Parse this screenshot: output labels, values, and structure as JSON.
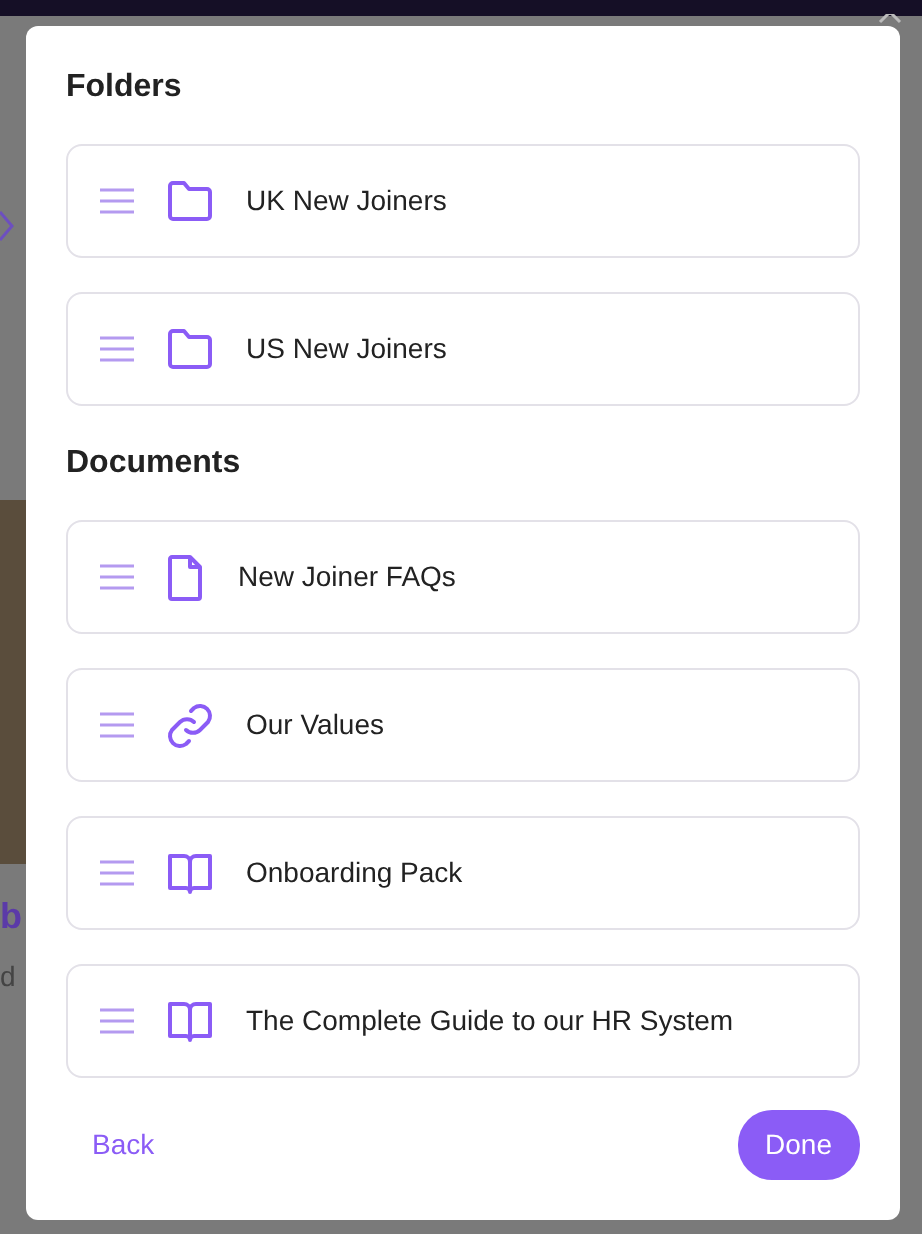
{
  "background": {
    "title_fragment": "b",
    "text_fragment": "d"
  },
  "sections": [
    {
      "title": "Folders",
      "items": [
        {
          "kind": "folder",
          "label": "UK New Joiners"
        },
        {
          "kind": "folder",
          "label": "US New Joiners"
        }
      ]
    },
    {
      "title": "Documents",
      "items": [
        {
          "kind": "file",
          "label": "New Joiner FAQs"
        },
        {
          "kind": "link",
          "label": "Our Values"
        },
        {
          "kind": "book",
          "label": "Onboarding Pack"
        },
        {
          "kind": "book",
          "label": "The Complete Guide to our HR System"
        }
      ]
    }
  ],
  "footer": {
    "back": "Back",
    "done": "Done"
  }
}
